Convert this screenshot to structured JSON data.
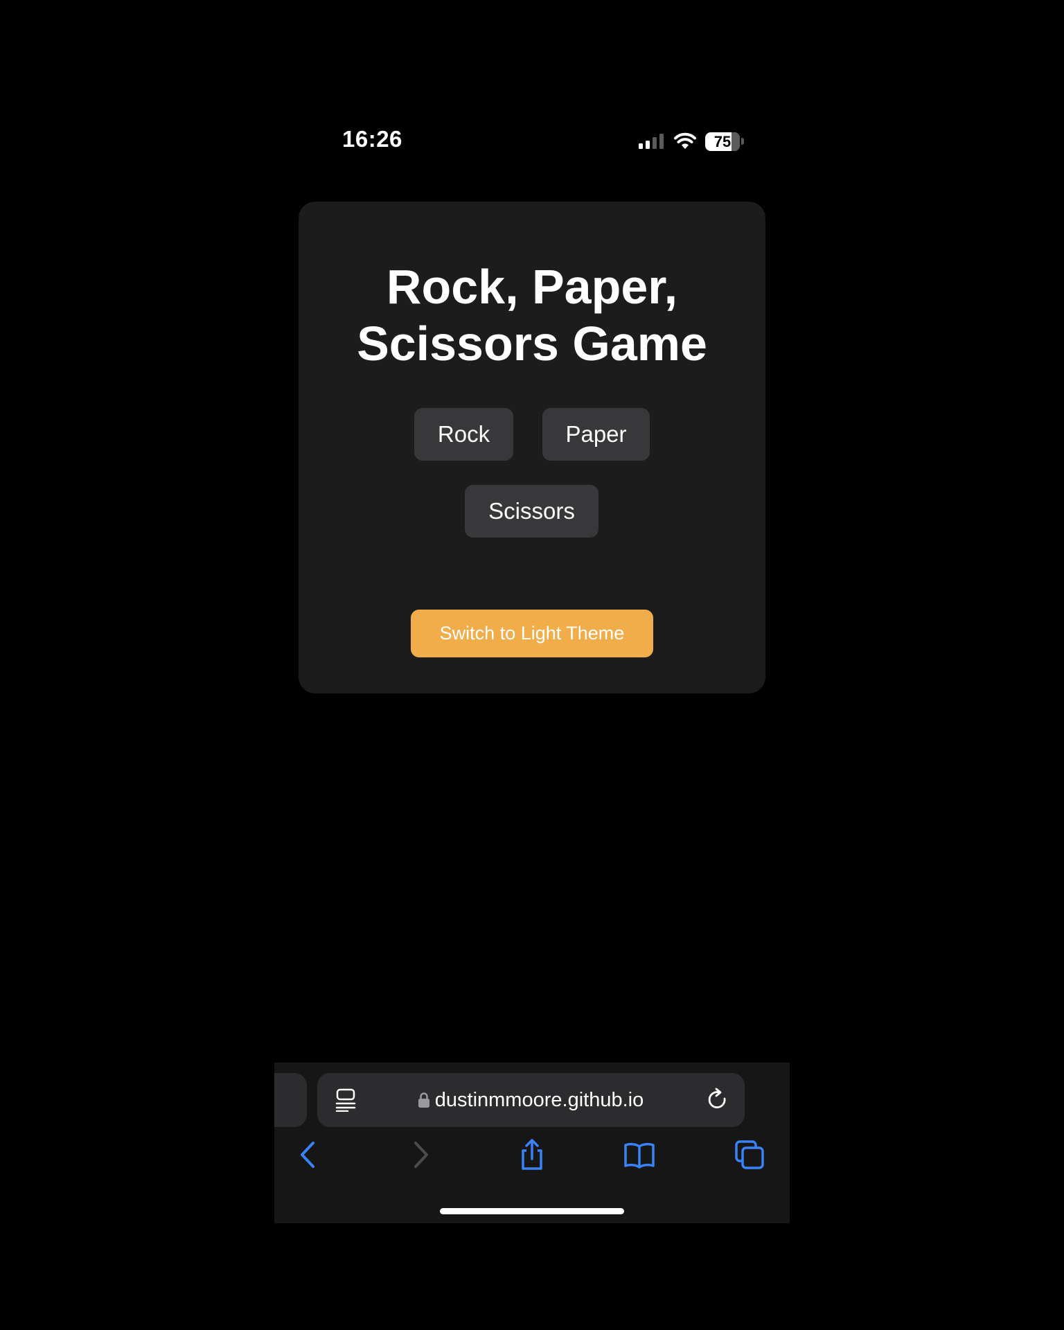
{
  "status_bar": {
    "time": "16:26",
    "battery": "75"
  },
  "game": {
    "title": "Rock, Paper, Scissors Game",
    "choices": [
      {
        "label": "Rock"
      },
      {
        "label": "Paper"
      },
      {
        "label": "Scissors"
      }
    ],
    "theme_toggle_label": "Switch to Light Theme"
  },
  "browser": {
    "url": "dustinmmoore.github.io",
    "toolbar_icons": [
      "reader-icon",
      "lock-icon",
      "reload-icon",
      "back-icon",
      "forward-icon",
      "share-icon",
      "bookmarks-icon",
      "tabs-icon"
    ]
  },
  "colors": {
    "background": "#000000",
    "card": "#1c1c1d",
    "button": "#38383a",
    "accent": "#f1ad4a",
    "toolbar_link": "#3a82f7"
  }
}
